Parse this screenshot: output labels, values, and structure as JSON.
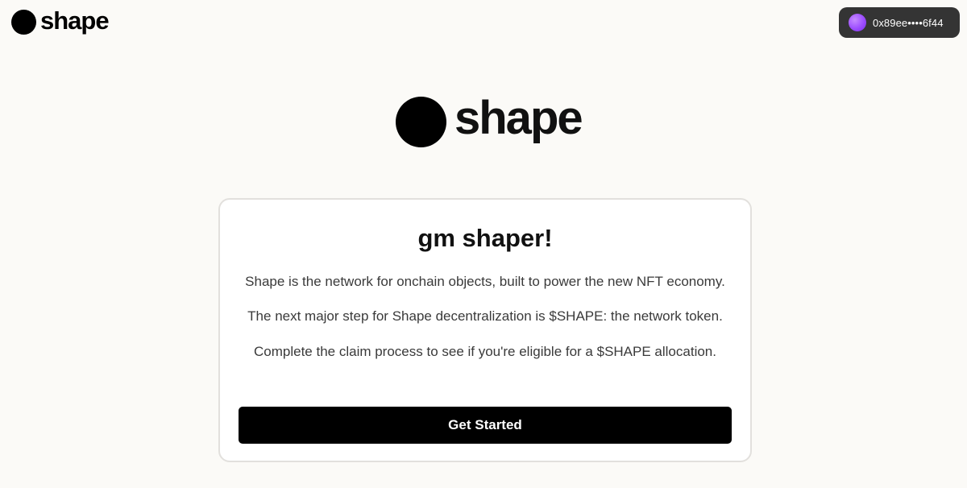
{
  "header": {
    "logo_text": "shape",
    "wallet": {
      "address": "0x89ee••••6f44",
      "avatar_color": "#9c4dff"
    }
  },
  "hero": {
    "logo_text": "shape"
  },
  "card": {
    "title": "gm shaper!",
    "paragraphs": [
      "Shape is the network for onchain objects, built to power the new NFT economy.",
      "The next major step for Shape decentralization is $SHAPE: the network token.",
      "Complete the claim process to see if you're eligible for a $SHAPE allocation."
    ],
    "cta_label": "Get Started"
  },
  "colors": {
    "background": "#fbfaf7",
    "button": "#000000",
    "wallet_bg": "#343434"
  }
}
